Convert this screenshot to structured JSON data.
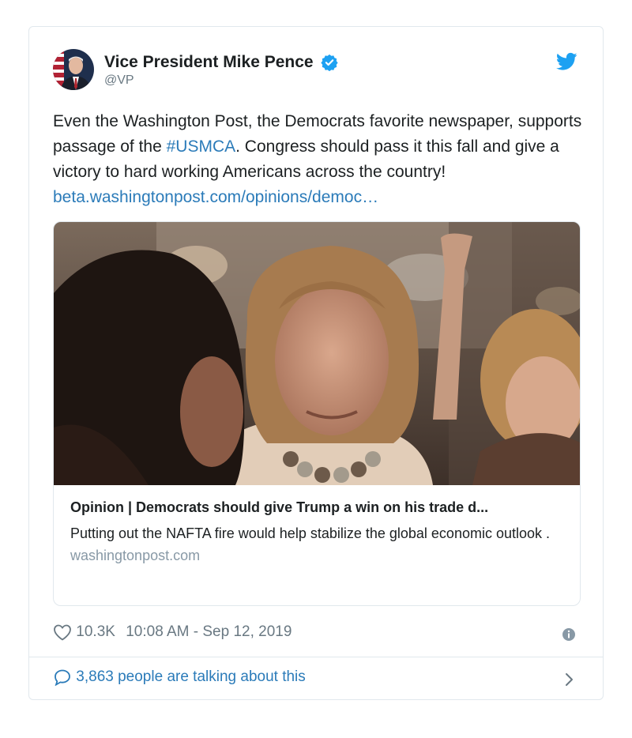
{
  "tweet": {
    "display_name": "Vice President Mike Pence",
    "handle": "@VP",
    "text_before": "Even the Washington Post, the Democrats favorite newspaper, supports passage of the ",
    "hashtag": "#USMCA",
    "text_after": ". Congress should pass it this fall and give a victory to hard working Americans across the country! ",
    "link": "beta.washingtonpost.com/opinions/democ…",
    "likes": "10.3K",
    "timestamp": "10:08 AM - Sep 12, 2019",
    "talking": "3,863 people are talking about this"
  },
  "card": {
    "title": "Opinion | Democrats should give Trump a win on his trade d...",
    "description": "Putting out the NAFTA fire would help stabilize the global economic outlook .",
    "domain": "washingtonpost.com"
  },
  "colors": {
    "accent": "#1da1f2",
    "link": "#2b7bb9",
    "muted": "#697882",
    "border": "#e1e8ed"
  },
  "icons": {
    "brand": "twitter-bird-icon",
    "verified": "verified-badge-icon",
    "like": "heart-icon",
    "info": "info-icon",
    "reply": "speech-bubble-icon",
    "more": "chevron-right-icon"
  }
}
